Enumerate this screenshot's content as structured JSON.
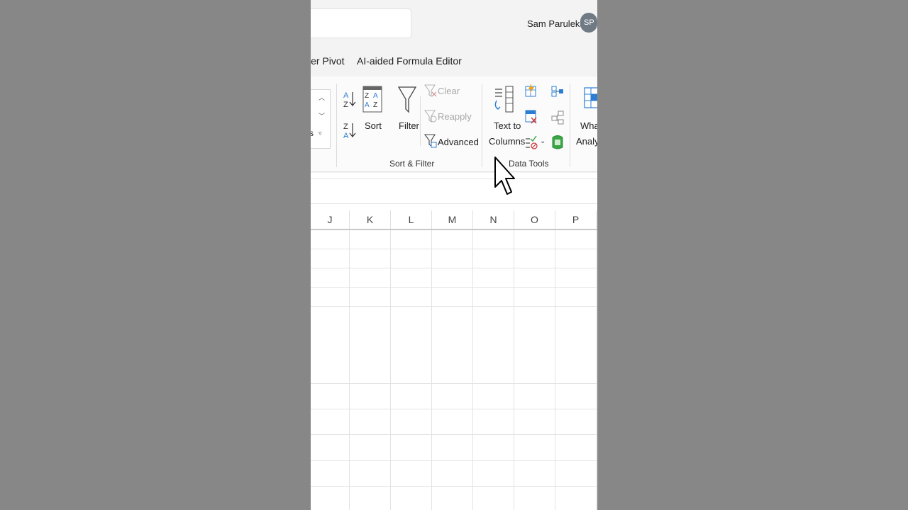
{
  "titlebar": {
    "user_name": "Sam Parulekar",
    "avatar_initials": "SP"
  },
  "tabs": [
    "wer Pivot",
    "AI-aided Formula Editor"
  ],
  "ribbon": {
    "sort_filter": {
      "sort_label": "Sort",
      "filter_label": "Filter",
      "clear_label": "Clear",
      "reapply_label": "Reapply",
      "advanced_label": "Advanced",
      "group_label": "Sort & Filter"
    },
    "data_tools": {
      "text_to_columns_line1": "Text to",
      "text_to_columns_line2": "Columns",
      "group_label": "Data Tools"
    },
    "what_if": {
      "line1": "What",
      "line2": "Analys"
    },
    "partial_label": "s"
  },
  "sheet": {
    "columns": [
      "J",
      "K",
      "L",
      "M",
      "N",
      "O",
      "P"
    ]
  },
  "colors": {
    "accent_blue": "#2b7cd3",
    "accent_green": "#3aa546",
    "accent_red": "#d13438"
  }
}
